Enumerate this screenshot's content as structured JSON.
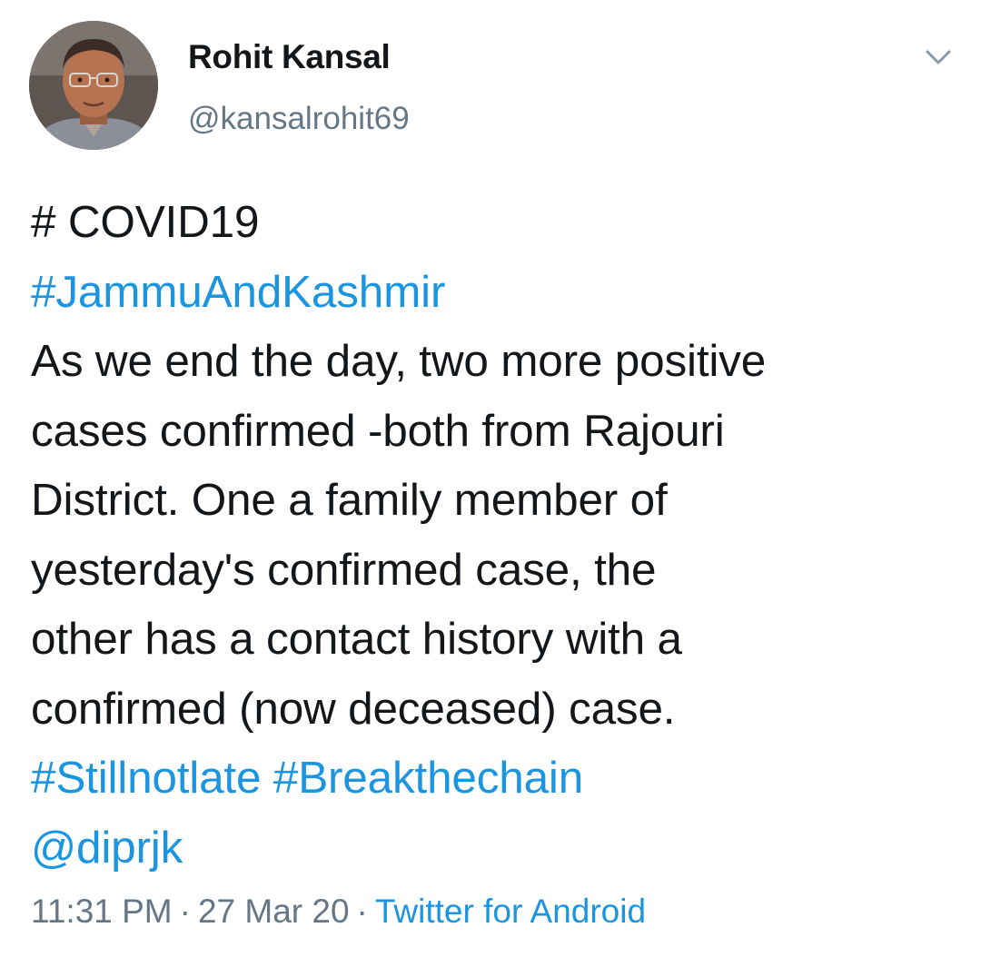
{
  "author": {
    "display_name": "Rohit Kansal",
    "handle": "@kansalrohit69"
  },
  "menu": {
    "icon": "chevron-down-icon"
  },
  "tweet": {
    "lines": [
      {
        "text": "# COVID19",
        "link": false
      },
      {
        "text": "#JammuAndKashmir",
        "link": true
      },
      {
        "text": "As we end the day,  two more positive",
        "link": false
      },
      {
        "text": "cases confirmed -both from Rajouri",
        "link": false
      },
      {
        "text": "District. One a family member of",
        "link": false
      },
      {
        "text": "yesterday's confirmed case, the",
        "link": false
      },
      {
        "text": "other has a contact history with a",
        "link": false
      },
      {
        "text": "confirmed (now deceased) case.",
        "link": false
      }
    ],
    "hashtag_still": "#Stillnotlate",
    "hashtag_break": "#Breakthechain",
    "mention": "@diprjk"
  },
  "meta": {
    "time": "11:31 PM",
    "separator": "·",
    "date": "27 Mar 20",
    "source": "Twitter for Android"
  },
  "colors": {
    "link": "#1b95e0",
    "muted": "#657786",
    "text": "#14171a"
  }
}
